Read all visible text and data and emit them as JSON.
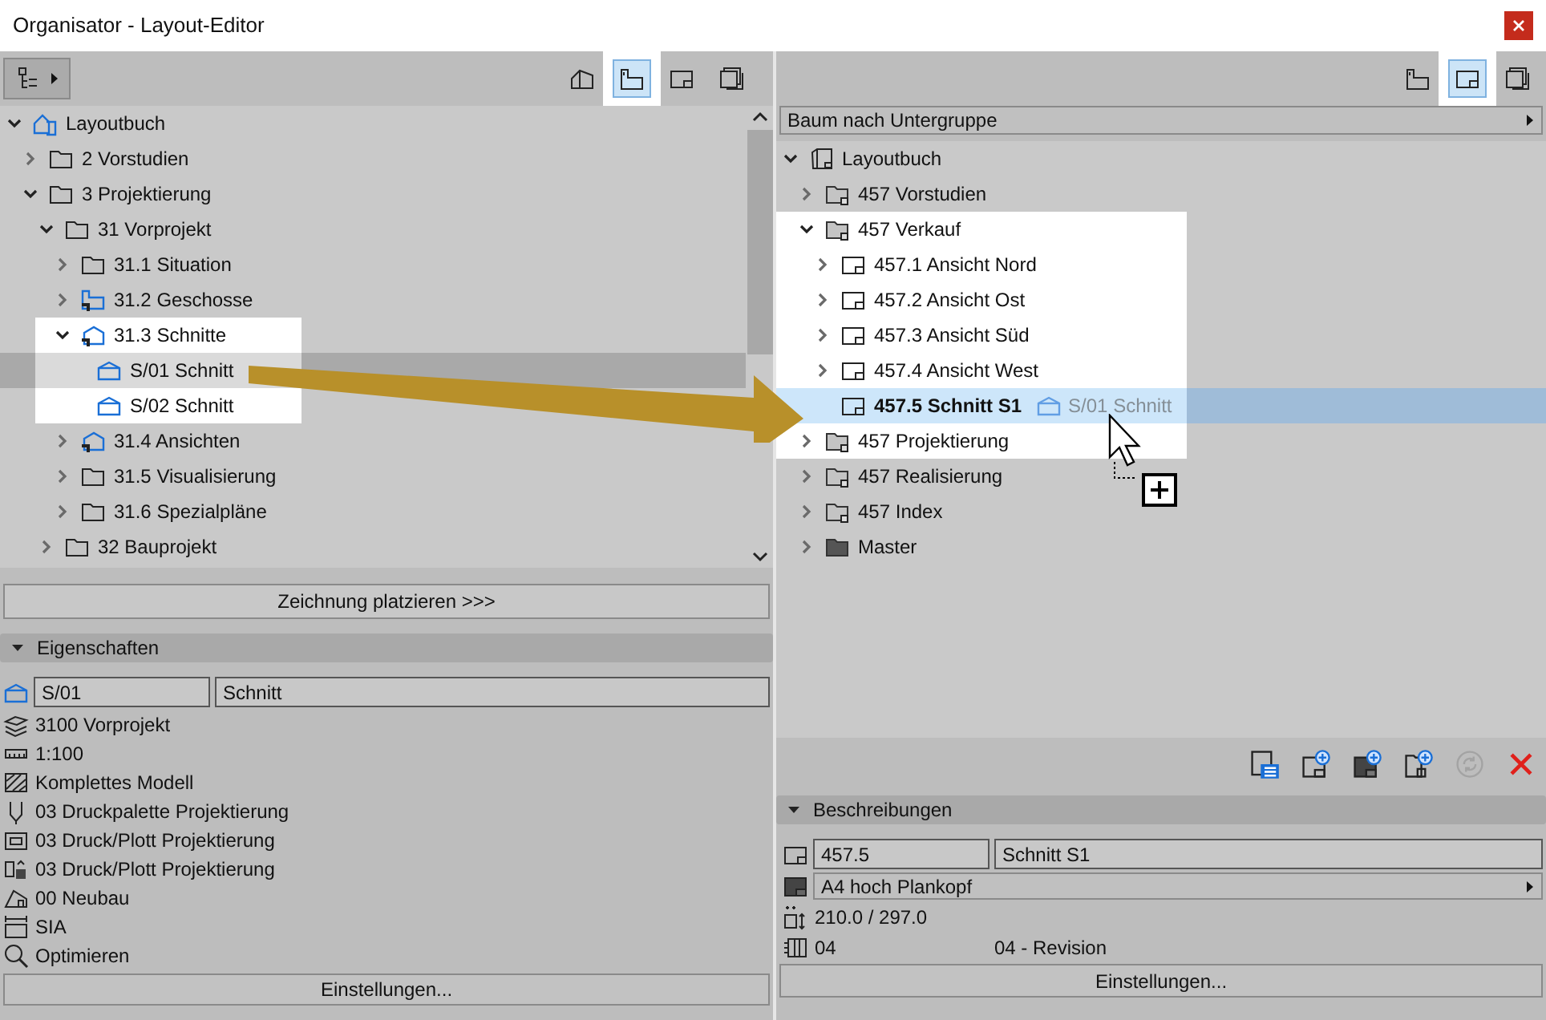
{
  "window": {
    "title": "Organisator - Layout-Editor"
  },
  "left_panel": {
    "view_buttons": [
      {
        "kind": "model",
        "selected": false
      },
      {
        "kind": "view",
        "selected": true
      },
      {
        "kind": "layout",
        "selected": false
      },
      {
        "kind": "publisher",
        "selected": false
      }
    ],
    "tree": [
      {
        "label": "Layoutbuch",
        "kind": "book",
        "expanded": true,
        "selected": false,
        "highlighted": false,
        "children": [
          {
            "label": "2 Vorstudien",
            "kind": "folder",
            "expanded": false,
            "selected": false,
            "highlighted": false
          },
          {
            "label": "3 Projektierung",
            "kind": "folder",
            "expanded": true,
            "selected": false,
            "highlighted": false,
            "children": [
              {
                "label": "31 Vorprojekt",
                "kind": "folder",
                "expanded": true,
                "selected": false,
                "highlighted": false,
                "children": [
                  {
                    "label": "31.1 Situation",
                    "kind": "folder",
                    "expanded": false,
                    "selected": false,
                    "highlighted": false
                  },
                  {
                    "label": "31.2 Geschosse",
                    "kind": "story",
                    "expanded": false,
                    "selected": false,
                    "highlighted": false
                  },
                  {
                    "label": "31.3 Schnitte",
                    "kind": "section_group",
                    "expanded": true,
                    "selected": false,
                    "highlighted": true,
                    "children": [
                      {
                        "label": "S/01 Schnitt",
                        "kind": "section",
                        "selected": true,
                        "highlighted": true
                      },
                      {
                        "label": "S/02 Schnitt",
                        "kind": "section",
                        "selected": false,
                        "highlighted": true
                      }
                    ]
                  },
                  {
                    "label": "31.4 Ansichten",
                    "kind": "section_group",
                    "expanded": false,
                    "selected": false,
                    "highlighted": false
                  },
                  {
                    "label": "31.5 Visualisierung",
                    "kind": "folder",
                    "expanded": false,
                    "selected": false,
                    "highlighted": false
                  },
                  {
                    "label": "31.6 Spezialpläne",
                    "kind": "folder",
                    "expanded": false,
                    "selected": false,
                    "highlighted": false
                  }
                ]
              },
              {
                "label": "32 Bauprojekt",
                "kind": "folder",
                "expanded": false,
                "selected": false,
                "highlighted": false
              }
            ]
          }
        ]
      }
    ],
    "place_button": "Zeichnung platzieren >>>",
    "properties": {
      "title": "Eigenschaften",
      "id": "S/01",
      "name": "Schnitt",
      "rows": [
        {
          "kind": "layers",
          "text": "3100 Vorprojekt"
        },
        {
          "kind": "scale",
          "text": "1:100"
        },
        {
          "kind": "model",
          "text": "Komplettes Modell"
        },
        {
          "kind": "pen",
          "text": "03 Druckpalette Projektierung"
        },
        {
          "kind": "display",
          "text": "03 Druck/Plott Projektierung"
        },
        {
          "kind": "override",
          "text": "03 Druck/Plott Projektierung"
        },
        {
          "kind": "renovation",
          "text": "00 Neubau"
        },
        {
          "kind": "dimension",
          "text": "SIA"
        },
        {
          "kind": "zoom",
          "text": "Optimieren"
        }
      ],
      "settings_button": "Einstellungen..."
    }
  },
  "right_panel": {
    "view_buttons": [
      {
        "kind": "view",
        "selected": false
      },
      {
        "kind": "layout",
        "selected": true
      },
      {
        "kind": "publisher",
        "selected": false
      }
    ],
    "tree_mode": "Baum nach Untergruppe",
    "tree": [
      {
        "label": "Layoutbuch",
        "kind": "layout_book",
        "expanded": true,
        "selected": false,
        "highlighted": false,
        "children": [
          {
            "label": "457 Vorstudien",
            "kind": "subset",
            "expanded": false,
            "selected": false,
            "highlighted": false
          },
          {
            "label": "457 Verkauf",
            "kind": "subset",
            "expanded": true,
            "selected": false,
            "highlighted": true,
            "children": [
              {
                "label": "457.1 Ansicht Nord",
                "kind": "layout",
                "expanded": false,
                "selected": false,
                "highlighted": true
              },
              {
                "label": "457.2 Ansicht Ost",
                "kind": "layout",
                "expanded": false,
                "selected": false,
                "highlighted": true
              },
              {
                "label": "457.3 Ansicht Süd",
                "kind": "layout",
                "expanded": false,
                "selected": false,
                "highlighted": true
              },
              {
                "label": "457.4 Ansicht West",
                "kind": "layout",
                "expanded": false,
                "selected": false,
                "highlighted": true
              },
              {
                "label": "457.5 Schnitt S1",
                "kind": "layout",
                "selected": true,
                "highlighted": true,
                "drag_ghost": "S/01 Schnitt"
              }
            ]
          },
          {
            "label": "457 Projektierung",
            "kind": "subset",
            "expanded": false,
            "selected": false,
            "highlighted": true
          },
          {
            "label": "457 Realisierung",
            "kind": "subset",
            "expanded": false,
            "selected": false,
            "highlighted": false
          },
          {
            "label": "457 Index",
            "kind": "subset",
            "expanded": false,
            "selected": false,
            "highlighted": false
          },
          {
            "label": "Master",
            "kind": "master",
            "expanded": false,
            "selected": false,
            "highlighted": false
          }
        ]
      }
    ],
    "actions": [
      {
        "kind": "list",
        "disabled": false
      },
      {
        "kind": "new_layout",
        "disabled": false
      },
      {
        "kind": "new_master",
        "disabled": false
      },
      {
        "kind": "new_subset",
        "disabled": false
      },
      {
        "kind": "update",
        "disabled": true
      },
      {
        "kind": "delete",
        "disabled": false
      }
    ],
    "descriptions": {
      "title": "Beschreibungen",
      "id": "457.5",
      "name": "Schnitt S1",
      "master": "A4 hoch Plankopf",
      "size": "210.0 / 297.0",
      "revision_id": "04",
      "revision_name": "04 - Revision",
      "settings_button": "Einstellungen..."
    }
  }
}
